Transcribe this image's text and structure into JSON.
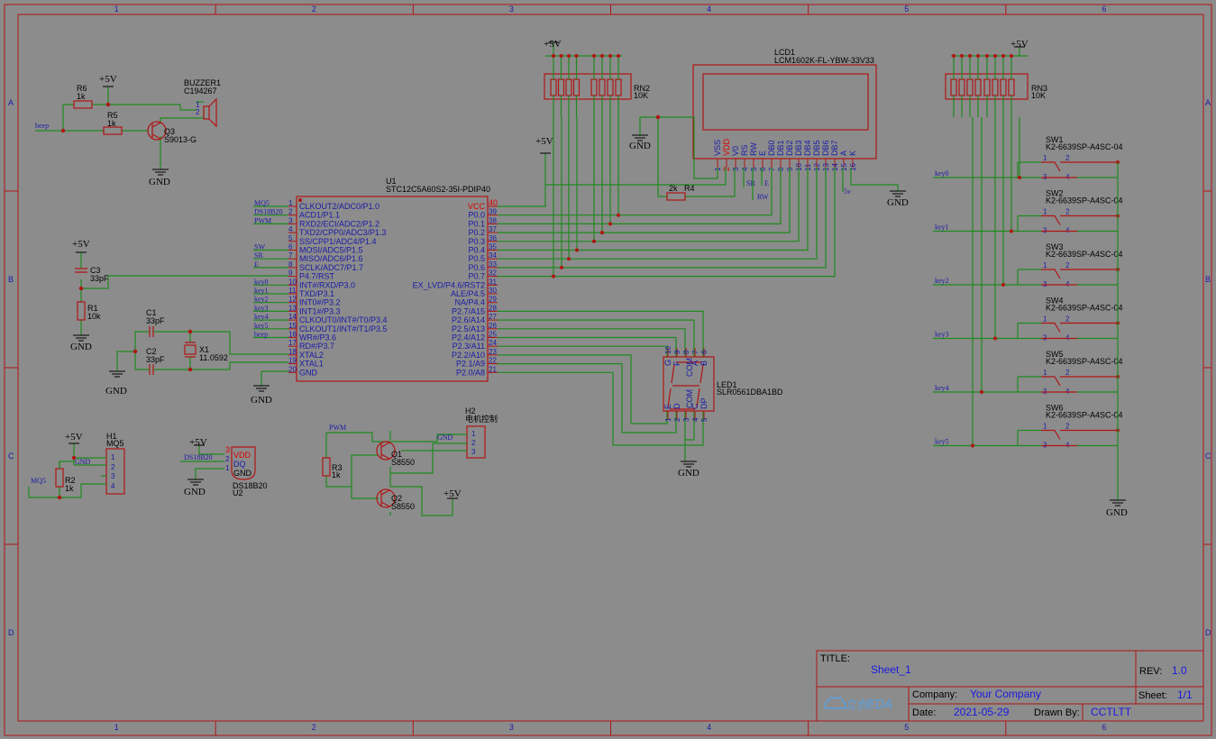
{
  "frame": {
    "cols": [
      "1",
      "2",
      "3",
      "4",
      "5",
      "6"
    ],
    "rows": [
      "A",
      "B",
      "C",
      "D"
    ]
  },
  "power": {
    "p5v": "+5V",
    "gnd": "GND",
    "v5": "5v"
  },
  "buzzer": {
    "r6": "R6",
    "r6v": "1k",
    "r5": "R5",
    "r5v": "1k",
    "ref": "BUZZER1",
    "part": "C194267",
    "q3": "Q3",
    "q3v": "S9013-G",
    "net": "beep",
    "p1": "1",
    "p2": "2"
  },
  "c3": {
    "ref": "C3",
    "val": "33pF"
  },
  "r1": {
    "ref": "R1",
    "val": "10k"
  },
  "crystal": {
    "c1": "C1",
    "c1v": "33pF",
    "c2": "C2",
    "c2v": "33pF",
    "x1": "X1",
    "x1v": "11.0592"
  },
  "mcu": {
    "ref": "U1",
    "part": "STC12C5A60S2-35I-PDIP40",
    "left": [
      {
        "n": "1",
        "f": "CLKOUT2/ADC0/P1.0",
        "net": "MQ5"
      },
      {
        "n": "2",
        "f": "ACD1/P1.1",
        "net": "DS18B20"
      },
      {
        "n": "3",
        "f": "RXD2/ECI/ADC2/P1.2",
        "net": "PWM"
      },
      {
        "n": "4",
        "f": "TXD2/CPP0/ADC3/P1.3",
        "net": ""
      },
      {
        "n": "5",
        "f": "SS/CPP1/ADC4/P1.4",
        "net": ""
      },
      {
        "n": "6",
        "f": "MOSI/ADC5/P1.5",
        "net": "SW"
      },
      {
        "n": "7",
        "f": "MISO/ADC6/P1.6",
        "net": "SR"
      },
      {
        "n": "8",
        "f": "SCLK/ADC7/P1.7",
        "net": "E"
      },
      {
        "n": "9",
        "f": "P4.7/RST",
        "net": ""
      },
      {
        "n": "10",
        "f": "INT#/RXD/P3.0",
        "net": "key0"
      },
      {
        "n": "11",
        "f": "TXD/P3.1",
        "net": "key1"
      },
      {
        "n": "12",
        "f": "INT0#/P3.2",
        "net": "key2"
      },
      {
        "n": "13",
        "f": "INT1#/P3.3",
        "net": "key3"
      },
      {
        "n": "14",
        "f": "CLKOUT0/INT#/T0/P3.4",
        "net": "key4"
      },
      {
        "n": "15",
        "f": "CLKOUT1/INT#/T1/P3.5",
        "net": "key5"
      },
      {
        "n": "16",
        "f": "WR#/P3.6",
        "net": "beep"
      },
      {
        "n": "17",
        "f": "RD#/P3.7",
        "net": ""
      },
      {
        "n": "18",
        "f": "XTAL2",
        "net": ""
      },
      {
        "n": "19",
        "f": "XTAL1",
        "net": ""
      },
      {
        "n": "20",
        "f": "GND",
        "net": ""
      }
    ],
    "right": [
      {
        "n": "40",
        "f": "VCC"
      },
      {
        "n": "39",
        "f": "P0.0"
      },
      {
        "n": "38",
        "f": "P0.1"
      },
      {
        "n": "37",
        "f": "P0.2"
      },
      {
        "n": "36",
        "f": "P0.3"
      },
      {
        "n": "35",
        "f": "P0.4"
      },
      {
        "n": "34",
        "f": "P0.5"
      },
      {
        "n": "33",
        "f": "P0.6"
      },
      {
        "n": "32",
        "f": "P0.7"
      },
      {
        "n": "31",
        "f": "EX_LVD/P4.6/RST2"
      },
      {
        "n": "30",
        "f": "ALE/P4.5"
      },
      {
        "n": "29",
        "f": "NA/P4.4"
      },
      {
        "n": "28",
        "f": "P2.7/A15"
      },
      {
        "n": "27",
        "f": "P2.6/A14"
      },
      {
        "n": "26",
        "f": "P2.5/A13"
      },
      {
        "n": "25",
        "f": "P2.4/A12"
      },
      {
        "n": "24",
        "f": "P2.3/A11"
      },
      {
        "n": "23",
        "f": "P2.2/A10"
      },
      {
        "n": "22",
        "f": "P2.1/A9"
      },
      {
        "n": "21",
        "f": "P2.0/A8"
      }
    ]
  },
  "rn2": {
    "ref": "RN2",
    "val": "10K"
  },
  "rn3": {
    "ref": "RN3",
    "val": "10K"
  },
  "r4": {
    "ref": "R4",
    "val": "2k"
  },
  "lcd": {
    "ref": "LCD1",
    "part": "LCM1602K-FL-YBW-33V33",
    "pins": [
      "VSS",
      "VDD",
      "V0",
      "RS",
      "RW",
      "E",
      "DB0",
      "DB1",
      "DB2",
      "DB3",
      "DB4",
      "DB5",
      "DB6",
      "DB7",
      "A",
      "K"
    ],
    "nets": {
      "sr": "SR",
      "e": "E",
      "rw": "RW"
    }
  },
  "led": {
    "ref": "LED1",
    "part": "SLR0561DBA1BD",
    "top_nums": [
      "10",
      "9",
      "8",
      "7",
      "6"
    ],
    "top_sigs": [
      "G",
      "F",
      "COM",
      "A",
      "B"
    ],
    "bot_nums": [
      "1",
      "2",
      "3",
      "4",
      "5"
    ],
    "bot_sigs": [
      "E",
      "D",
      "COM",
      "C",
      "DP"
    ]
  },
  "switches": [
    {
      "ref": "SW1",
      "part": "K2-6639SP-A4SC-04",
      "net": "key0"
    },
    {
      "ref": "SW2",
      "part": "K2-6639SP-A4SC-04",
      "net": "key1"
    },
    {
      "ref": "SW3",
      "part": "K2-6639SP-A4SC-04",
      "net": "key2"
    },
    {
      "ref": "SW4",
      "part": "K2-6639SP-A4SC-04",
      "net": "key3"
    },
    {
      "ref": "SW5",
      "part": "K2-6639SP-A4SC-04",
      "net": "key4"
    },
    {
      "ref": "SW6",
      "part": "K2-6639SP-A4SC-04",
      "net": "key5"
    }
  ],
  "h1": {
    "ref": "H1",
    "part": "MQ5",
    "net": "MQ5",
    "gnd": "GND",
    "r2": "R2",
    "r2v": "1k",
    "pins": [
      "1",
      "2",
      "3",
      "4"
    ]
  },
  "u2": {
    "ref": "U2",
    "part": "DS18B20",
    "net": "DS18B20",
    "vdd": "VDD",
    "dq": "DQ",
    "gnd": "GND",
    "pins": [
      "3",
      "2",
      "1"
    ]
  },
  "motor": {
    "h2": "H2",
    "h2v": "电机控制",
    "pwm": "PWM",
    "gnd": "GND",
    "r3": "R3",
    "r3v": "1k",
    "q1": "Q1",
    "q1v": "S8550",
    "q2": "Q2",
    "q2v": "S8550",
    "pins": [
      "1",
      "2",
      "3"
    ]
  },
  "titleblock": {
    "title_label": "TITLE:",
    "title": "Sheet_1",
    "rev_label": "REV:",
    "rev": "1.0",
    "company_label": "Company:",
    "company": "Your Company",
    "sheet_label": "Sheet:",
    "sheet": "1/1",
    "date_label": "Date:",
    "date": "2021-05-29",
    "drawn_label": "Drawn By:",
    "drawn": "CCTLTT",
    "logo": "立创EDA"
  }
}
